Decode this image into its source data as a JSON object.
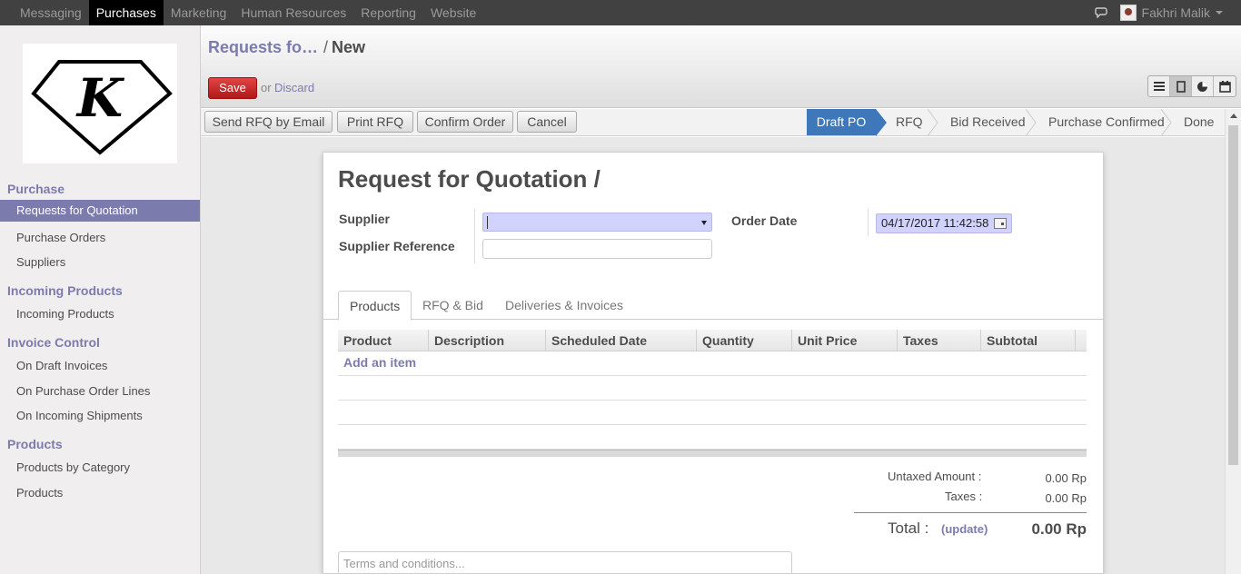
{
  "topbar": {
    "menus": [
      "Messaging",
      "Purchases",
      "Marketing",
      "Human Resources",
      "Reporting",
      "Website"
    ],
    "user": "Fakhri Malik"
  },
  "sidebar": {
    "sections": [
      {
        "title": "Purchase",
        "items": [
          "Requests for Quotation",
          "Purchase Orders",
          "Suppliers"
        ]
      },
      {
        "title": "Incoming Products",
        "items": [
          "Incoming Products"
        ]
      },
      {
        "title": "Invoice Control",
        "items": [
          "On Draft Invoices",
          "On Purchase Order Lines",
          "On Incoming Shipments"
        ]
      },
      {
        "title": "Products",
        "items": [
          "Products by Category",
          "Products"
        ]
      }
    ],
    "active_item": "Requests for Quotation",
    "logo_letter": "K"
  },
  "header": {
    "breadcrumb_link": "Requests fo…",
    "breadcrumb_sep": "/",
    "breadcrumb_current": "New",
    "save_label": "Save",
    "or_text": "or",
    "discard_label": "Discard",
    "views": [
      "list-view-icon",
      "form-view-icon",
      "graph-view-icon",
      "calendar-view-icon"
    ],
    "active_view": "form-view-icon"
  },
  "actions": [
    "Send RFQ by Email",
    "Print RFQ",
    "Confirm Order",
    "Cancel"
  ],
  "stages": [
    "Draft PO",
    "RFQ",
    "Bid Received",
    "Purchase Confirmed",
    "Done"
  ],
  "active_stage": "Draft PO",
  "form": {
    "title": "Request for Quotation /",
    "supplier_label": "Supplier",
    "supplier_value": "",
    "supplier_ref_label": "Supplier Reference",
    "supplier_ref_value": "",
    "order_date_label": "Order Date",
    "order_date_value": "04/17/2017 11:42:58",
    "tabs": [
      "Products",
      "RFQ & Bid",
      "Deliveries & Invoices"
    ],
    "active_tab": "Products",
    "columns": [
      "Product",
      "Description",
      "Scheduled Date",
      "Quantity",
      "Unit Price",
      "Taxes",
      "Subtotal"
    ],
    "add_item": "Add an item",
    "untaxed_label": "Untaxed Amount :",
    "untaxed_value": "0.00 Rp",
    "taxes_label": "Taxes :",
    "taxes_value": "0.00 Rp",
    "total_label": "Total :",
    "update_label": "(update)",
    "total_value": "0.00 Rp",
    "terms_placeholder": "Terms and conditions..."
  },
  "colors": {
    "accent": "#7c7bad",
    "save": "#d32f2f",
    "active_stage": "#3e78ba",
    "topbar": "#414141"
  }
}
